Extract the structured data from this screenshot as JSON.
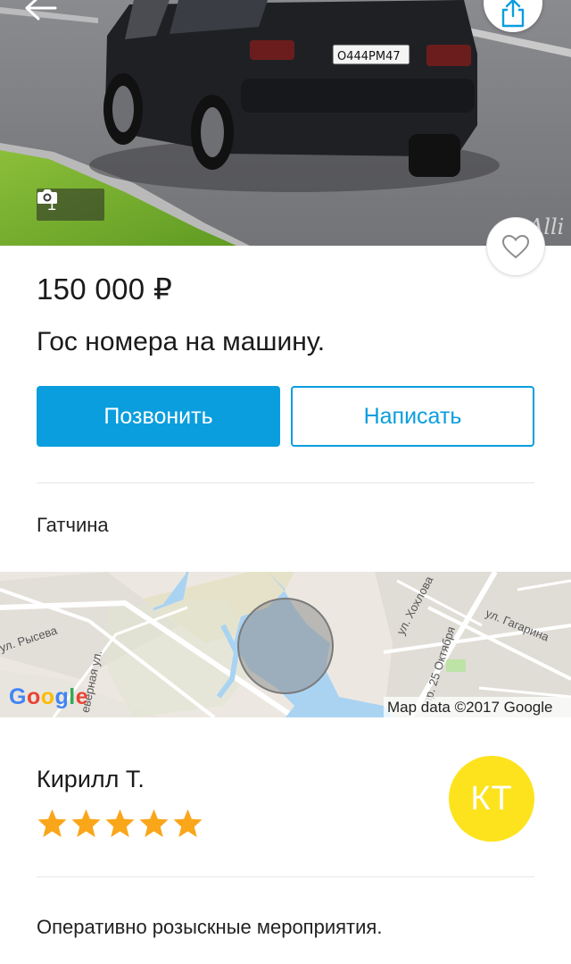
{
  "listing": {
    "photo_count": "1",
    "price": "150 000 ₽",
    "title": "Гос номера на машину.",
    "plate_text": "О444РМ47",
    "watermark": "Alli"
  },
  "actions": {
    "call_label": "Позвонить",
    "write_label": "Написать"
  },
  "location": {
    "city": "Гатчина"
  },
  "map": {
    "labels": {
      "street_1": "ул. Рысева",
      "street_2": "еверная ул.",
      "street_3": "ул. Хохлова",
      "street_4": "пр. 25 Октября",
      "street_5": "ул. Гагарина"
    },
    "logo": [
      "G",
      "o",
      "o",
      "g",
      "l",
      "e"
    ],
    "attribution": "Map data ©2017 Google"
  },
  "seller": {
    "name": "Кирилл Т.",
    "initials": "КТ",
    "rating": 5,
    "rating_max": 5
  },
  "description": "Оперативно розыскные мероприятия.",
  "colors": {
    "accent": "#0a9ede",
    "avatar": "#fde31d",
    "star": "#f9a61a"
  },
  "icons": {
    "back": "arrow-left-icon",
    "share": "share-icon",
    "camera": "camera-icon",
    "favorite": "heart-icon",
    "star": "star-icon"
  }
}
